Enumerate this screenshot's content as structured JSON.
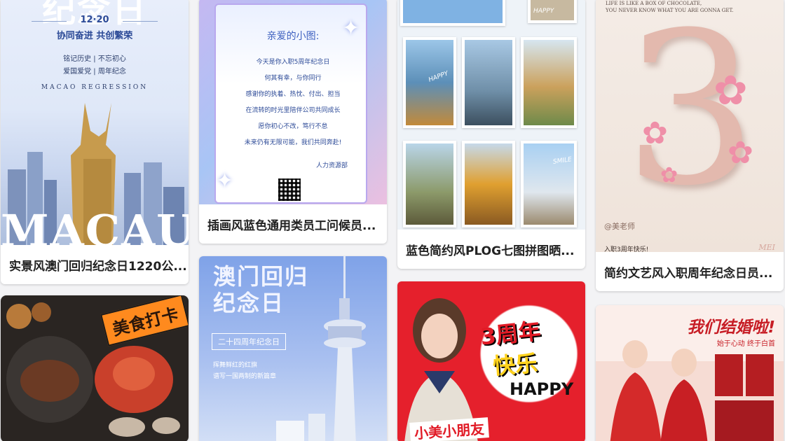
{
  "cards": [
    {
      "caption": "实景风澳门回归纪念日1220公...",
      "poster": {
        "big_title": "纪念日",
        "date": "12·20",
        "slogan": "协同奋进 共创繁荣",
        "line1": "铭记历史 | 不忘初心",
        "line2": "爱国爱党 | 周年纪念",
        "english": "MACAO REGRESSION",
        "city_word": "MACAU"
      }
    },
    {
      "caption": "插画风蓝色通用类员工问候员...",
      "poster": {
        "greeting": "亲爱的小图:",
        "lines": [
          "今天是你入职5周年纪念日",
          "何其有幸，与你同行",
          "感谢你的执着、热忱、付出、担当",
          "在流转的时光里陪伴公司共同成长",
          "愿你初心不改，笃行不怠",
          "未来仍有无限可能，我们共同奔赴!"
        ],
        "signature": "人力资源部"
      }
    },
    {
      "caption": "蓝色简约风PLOG七图拼图晒...",
      "poster": {
        "tags": [
          "HAPPY",
          "HAPPY",
          "SMILE"
        ]
      }
    },
    {
      "caption": "简约文艺风入职周年纪念日员...",
      "poster": {
        "en_line1": "LIFE IS LIKE A BOX OF CHOCOLATE,",
        "en_line2": "YOU NEVER KNOW WHAT YOU ARE GONNA GET.",
        "number": "3",
        "teacher": "@美老师",
        "footer": "入职3周年快乐!",
        "mark": "MEI"
      }
    },
    {
      "caption": "",
      "poster": {
        "banner": "美食打卡"
      }
    },
    {
      "caption": "",
      "poster": {
        "title_line1": "澳门回归",
        "title_line2": "纪念日",
        "badge": "二十四周年纪念日",
        "sub1": "挥舞鲜红的红旗",
        "sub2": "谱写一国两制的新篇章"
      }
    },
    {
      "caption": "",
      "poster": {
        "line1": "3周年",
        "line2": "快乐",
        "line3": "HAPPY",
        "name": "小美小朋友"
      }
    },
    {
      "caption": "",
      "poster": {
        "title": "我们结婚啦!",
        "sub": "始于心动 终于白首"
      }
    }
  ],
  "colors": {
    "macao_blue": "#2c4a97",
    "ticket_purple": "#b9a8ee",
    "rose": "#e3b9ae",
    "food_orange": "#ff8a1e",
    "comic_red": "#e5202c",
    "wedding_red": "#c71d25"
  }
}
